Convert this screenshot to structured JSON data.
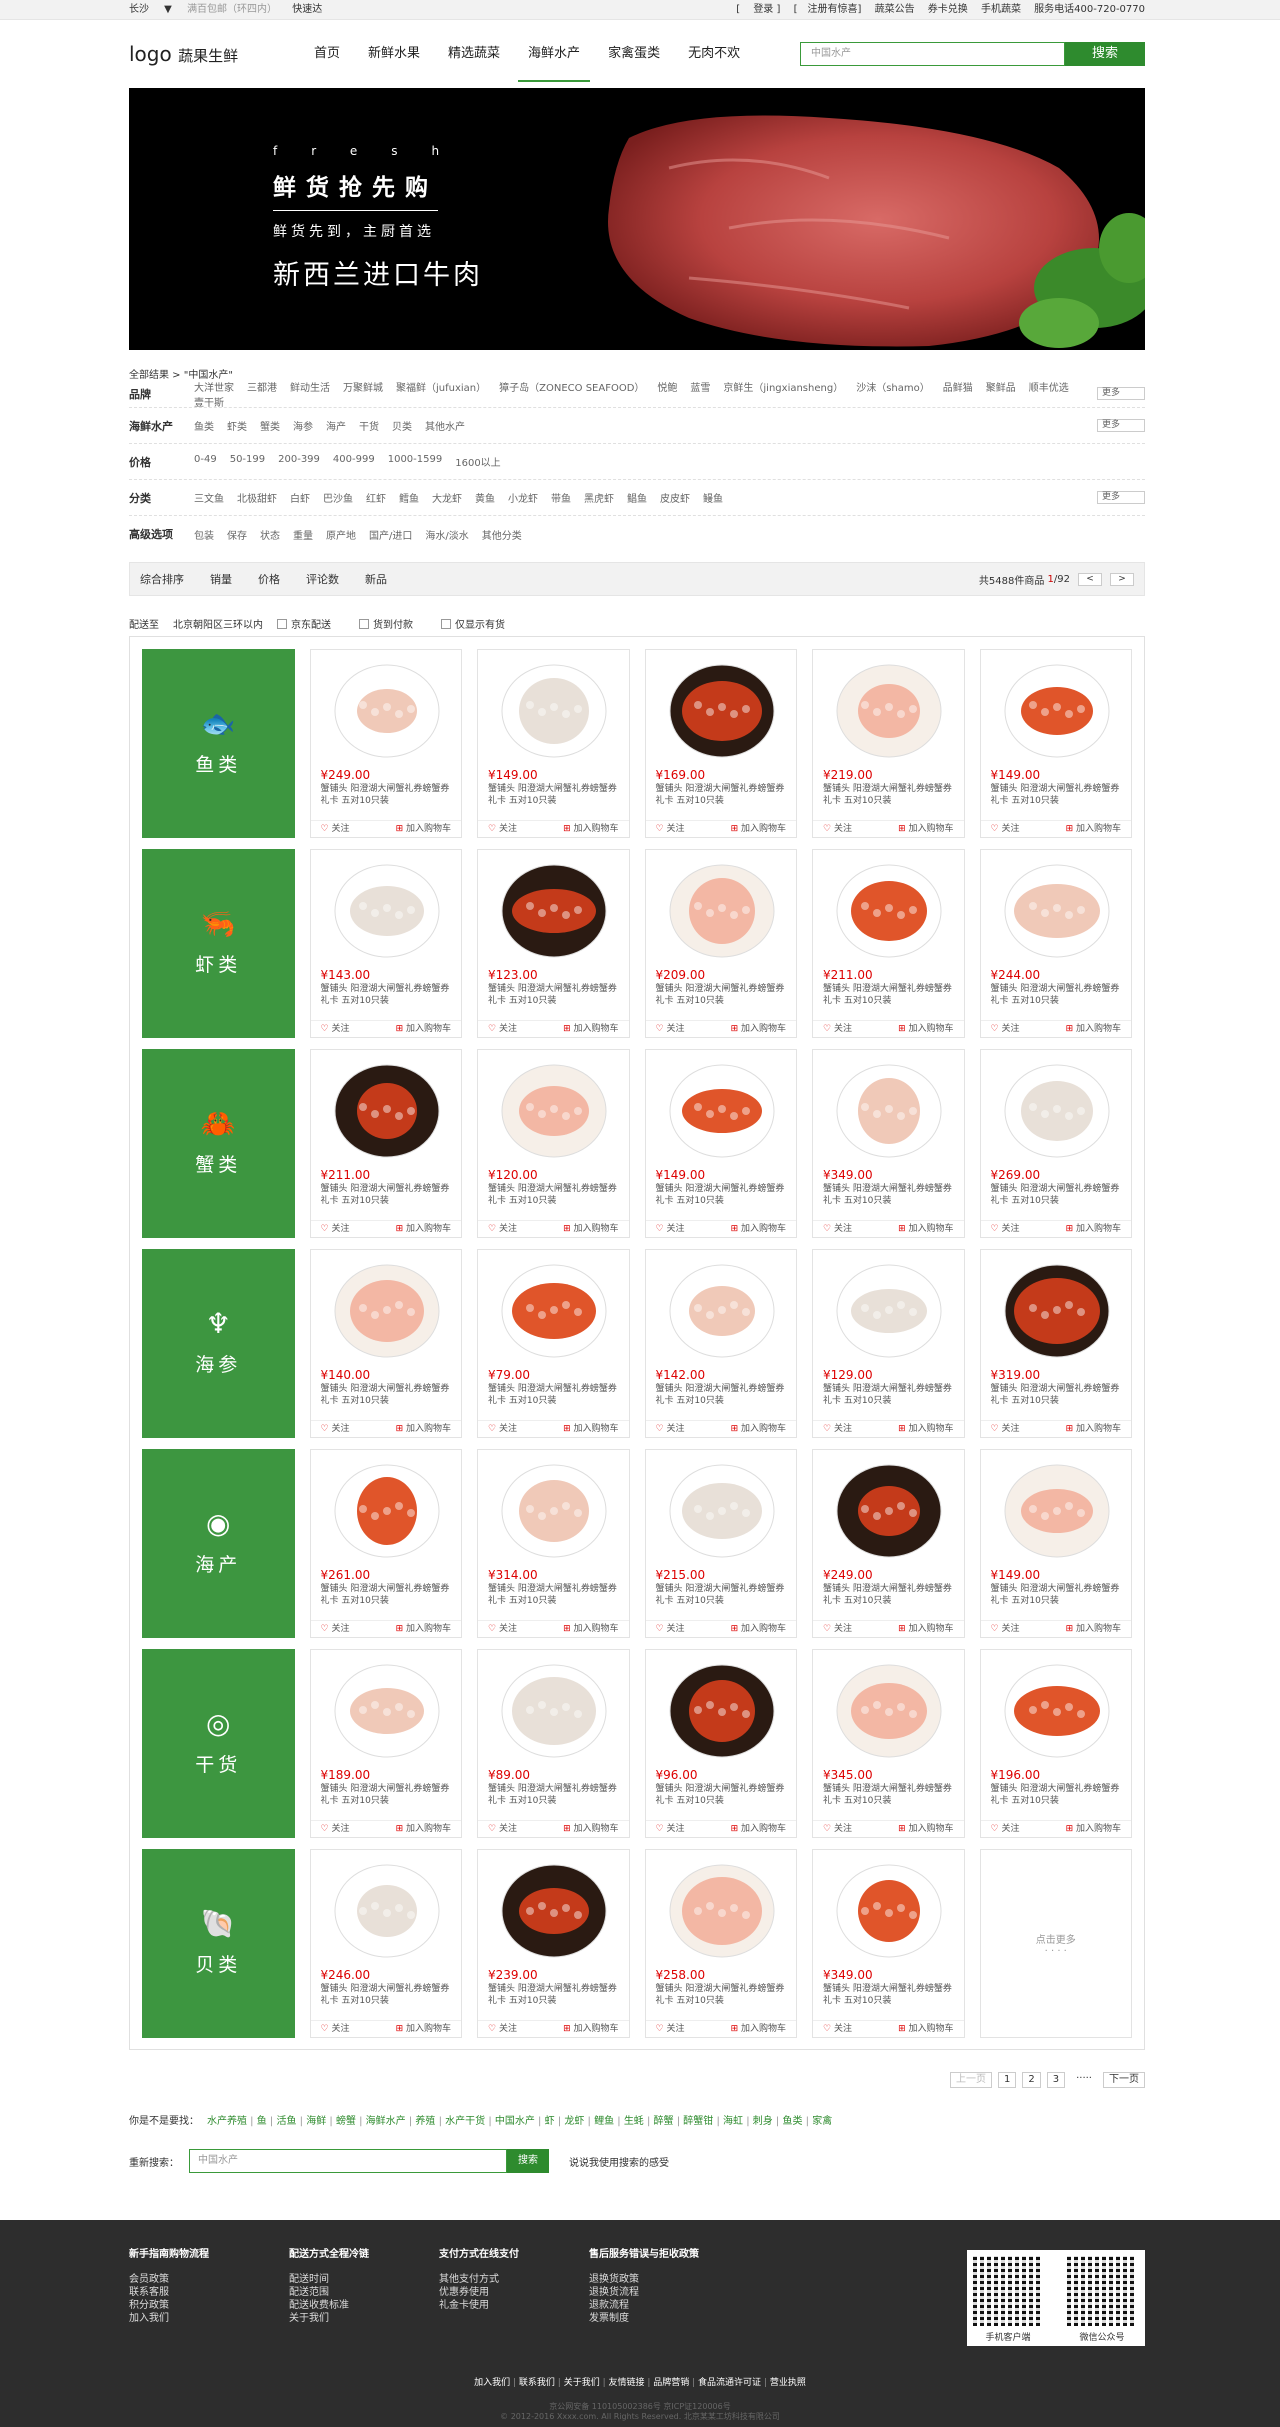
{
  "topbar": {
    "city": "长沙",
    "note": "满百包邮（环四内）",
    "fast": "快速达",
    "login": "登录",
    "register": "注册有惊喜",
    "links": [
      "蔬菜公告",
      "券卡兑换",
      "手机蔬菜"
    ],
    "phone": "服务电话400-720-0770"
  },
  "header": {
    "logo_a": "logo",
    "logo_b": "蔬果生鲜",
    "nav": [
      "首页",
      "新鲜水果",
      "精选蔬菜",
      "海鲜水产",
      "家禽蛋类",
      "无肉不欢"
    ],
    "search_placeholder": "中国水产",
    "search_btn": "搜索"
  },
  "banner": {
    "fresh": "fresh",
    "big": "鲜货抢先购",
    "sub": "鲜货先到，主厨首选",
    "main": "新西兰进口牛肉"
  },
  "crumb": "全部结果 > \"中国水产\"",
  "filters": [
    {
      "label": "品牌",
      "values": [
        "大洋世家",
        "三都港",
        "鲜动生活",
        "万聚鲜城",
        "聚福鲜（jufuxian）",
        "獐子岛（ZONECO SEAFOOD）",
        "悦鲍",
        "蓝雪",
        "京鲜生（jingxiansheng）",
        "沙沫（shamo）",
        "品鲜猫",
        "聚鲜品",
        "顺丰优选",
        "壹干斯"
      ],
      "more": "更多"
    },
    {
      "label": "海鲜水产",
      "values": [
        "鱼类",
        "虾类",
        "蟹类",
        "海参",
        "海产",
        "干货",
        "贝类",
        "其他水产"
      ],
      "more": "更多"
    },
    {
      "label": "价格",
      "values": [
        "0-49",
        "50-199",
        "200-399",
        "400-999",
        "1000-1599",
        "1600以上"
      ],
      "more": ""
    },
    {
      "label": "分类",
      "values": [
        "三文鱼",
        "北极甜虾",
        "白虾",
        "巴沙鱼",
        "红虾",
        "鳕鱼",
        "大龙虾",
        "黄鱼",
        "小龙虾",
        "带鱼",
        "黑虎虾",
        "鲳鱼",
        "皮皮虾",
        "鳗鱼"
      ],
      "more": "更多"
    },
    {
      "label": "高级选项",
      "values": [
        "包装",
        "保存",
        "状态",
        "重量",
        "原产地",
        "国产/进口",
        "海水/淡水",
        "其他分类"
      ],
      "more": ""
    }
  ],
  "sort": {
    "items": [
      "综合排序",
      "销量",
      "价格",
      "评论数",
      "新品"
    ],
    "total": "共5488件商品",
    "page": "1",
    "pages": "/92",
    "prev": "<",
    "next": ">"
  },
  "delivery": {
    "label": "配送至",
    "place": "北京朝阳区三环以内",
    "opts": [
      "京东配送",
      "货到付款",
      "仅显示有货"
    ]
  },
  "product": {
    "desc": "蟹铺头 阳澄湖大闸蟹礼券螃蟹券礼卡 五对10只装",
    "follow": "关注",
    "cart": "加入购物车"
  },
  "categories": [
    {
      "name": "鱼类",
      "icon": "fish-icon",
      "glyph": "🐟",
      "prices": [
        "¥249.00",
        "¥149.00",
        "¥169.00",
        "¥219.00",
        "¥149.00"
      ]
    },
    {
      "name": "虾类",
      "icon": "shrimp-icon",
      "glyph": "🦐",
      "prices": [
        "¥143.00",
        "¥123.00",
        "¥209.00",
        "¥211.00",
        "¥244.00"
      ]
    },
    {
      "name": "蟹类",
      "icon": "crab-icon",
      "glyph": "🦀",
      "prices": [
        "¥211.00",
        "¥120.00",
        "¥149.00",
        "¥349.00",
        "¥269.00"
      ]
    },
    {
      "name": "海参",
      "icon": "seahorse-icon",
      "glyph": "♆",
      "prices": [
        "¥140.00",
        "¥79.00",
        "¥142.00",
        "¥129.00",
        "¥319.00"
      ]
    },
    {
      "name": "海产",
      "icon": "fish-circle-icon",
      "glyph": "◉",
      "prices": [
        "¥261.00",
        "¥314.00",
        "¥215.00",
        "¥249.00",
        "¥149.00"
      ]
    },
    {
      "name": "干货",
      "icon": "shrimp-circle-icon",
      "glyph": "◎",
      "prices": [
        "¥189.00",
        "¥89.00",
        "¥96.00",
        "¥345.00",
        "¥196.00"
      ]
    },
    {
      "name": "贝类",
      "icon": "shell-icon",
      "glyph": "🐚",
      "prices": [
        "¥246.00",
        "¥239.00",
        "¥258.00",
        "¥349.00"
      ]
    }
  ],
  "more_card": {
    "text": "点击更多",
    "dots": "· · · ·"
  },
  "pager": {
    "prev": "上一页",
    "pages": [
      "1",
      "2",
      "3"
    ],
    "dots": "·····",
    "next": "下一页"
  },
  "hot": {
    "label": "你是不是要找：",
    "items": [
      "水产养殖",
      "鱼",
      "活鱼",
      "海鲜",
      "螃蟹",
      "海鲜水产",
      "养殖",
      "水产干货",
      "中国水产",
      "虾",
      "龙虾",
      "鲤鱼",
      "生蚝",
      "醉蟹",
      "醉蟹钳",
      "海虹",
      "刺身",
      "鱼类",
      "家禽"
    ]
  },
  "research": {
    "label": "重新搜索：",
    "placeholder": "中国水产",
    "btn": "搜索",
    "tip": "说说我使用搜索的感受"
  },
  "footer": {
    "cols": [
      {
        "title": "新手指南购物流程",
        "items": [
          "会员政策",
          "联系客服",
          "积分政策",
          "加入我们"
        ]
      },
      {
        "title": "配送方式全程冷链",
        "items": [
          "配送时间",
          "配送范围",
          "配送收费标准",
          "关于我们"
        ]
      },
      {
        "title": "支付方式在线支付",
        "items": [
          "其他支付方式",
          "优惠券使用",
          "礼金卡使用"
        ]
      },
      {
        "title": "售后服务错误与拒收政策",
        "items": [
          "退换货政策",
          "退换货流程",
          "退款流程",
          "发票制度"
        ]
      }
    ],
    "qr1": "手机客户端",
    "qr2": "微信公众号",
    "links": [
      "加入我们",
      "联系我们",
      "关于我们",
      "友情链接",
      "品牌营销",
      "食品流通许可证",
      "营业执照"
    ],
    "copy1": "京公网安备 110105002386号  京ICP证120006号",
    "copy2": "© 2012-2016 Xxxx.com. All Rights Reserved. 北京某某工坊科技有限公司"
  },
  "colors": {
    "brand": "#3d9640",
    "price": "#dd0000"
  }
}
